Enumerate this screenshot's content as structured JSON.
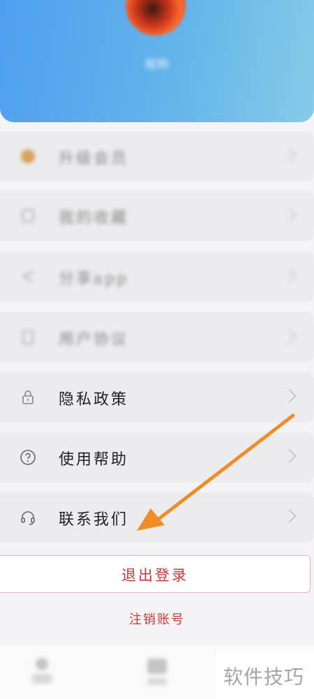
{
  "profile": {
    "username": "昵称"
  },
  "menu": [
    {
      "label": "升级会员",
      "icon": "crown-icon",
      "blurred": true
    },
    {
      "label": "我的收藏",
      "icon": "star-icon",
      "blurred": true
    },
    {
      "label": "分享app",
      "icon": "share-icon",
      "blurred": true
    },
    {
      "label": "用户协议",
      "icon": "document-icon",
      "blurred": true
    },
    {
      "label": "隐私政策",
      "icon": "lock-icon",
      "blurred": false
    },
    {
      "label": "使用帮助",
      "icon": "question-icon",
      "blurred": false
    },
    {
      "label": "联系我们",
      "icon": "headset-icon",
      "blurred": false
    }
  ],
  "actions": {
    "logout": "退出登录",
    "cancel_account": "注销账号"
  },
  "watermark": "软件技巧",
  "colors": {
    "header": "#5aa9ee",
    "danger": "#c43a3a",
    "arrow": "#f08c2a"
  }
}
